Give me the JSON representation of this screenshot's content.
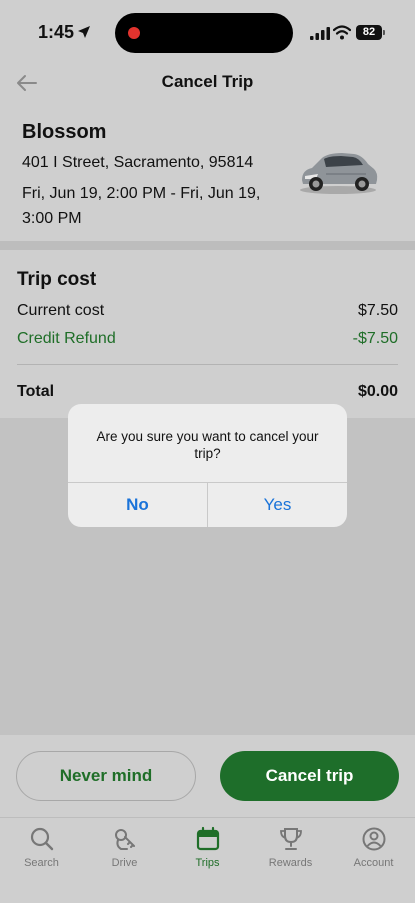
{
  "status_bar": {
    "time": "1:45",
    "battery": "82"
  },
  "header": {
    "title": "Cancel Trip"
  },
  "trip": {
    "vehicle_name": "Blossom",
    "address": "401 I Street, Sacramento, 95814",
    "dates": "Fri, Jun 19, 2:00 PM - Fri, Jun 19, 3:00 PM"
  },
  "cost": {
    "title": "Trip cost",
    "current_label": "Current cost",
    "current_value": "$7.50",
    "credit_label": "Credit Refund",
    "credit_value": "-$7.50",
    "total_label": "Total",
    "total_value": "$0.00"
  },
  "dialog": {
    "message": "Are you sure you want to cancel your trip?",
    "no_label": "No",
    "yes_label": "Yes"
  },
  "actions": {
    "never_mind_label": "Never mind",
    "cancel_label": "Cancel trip"
  },
  "tabs": [
    {
      "label": "Search",
      "icon": "search-icon"
    },
    {
      "label": "Drive",
      "icon": "key-icon"
    },
    {
      "label": "Trips",
      "icon": "calendar-icon",
      "active": true
    },
    {
      "label": "Rewards",
      "icon": "trophy-icon"
    },
    {
      "label": "Account",
      "icon": "person-icon"
    }
  ],
  "colors": {
    "brand_green": "#1e6e2a",
    "link_blue": "#1a73d9"
  }
}
